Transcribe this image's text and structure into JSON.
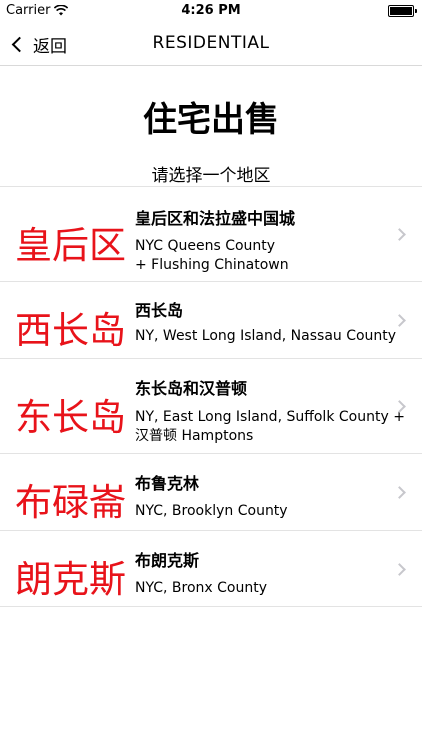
{
  "status_bar": {
    "carrier": "Carrier",
    "time": "4:26 PM"
  },
  "nav": {
    "back_label": "返回",
    "title": "RESIDENTIAL"
  },
  "page": {
    "title": "住宅出售",
    "subtitle": "请选择一个地区"
  },
  "regions": [
    {
      "short": "皇后区",
      "name": "皇后区和法拉盛中国城",
      "desc_line1": "NYC Queens County",
      "desc_line2": "+ Flushing Chinatown"
    },
    {
      "short": "西长岛",
      "name": "西长岛",
      "desc_line1": "NY, West Long Island, Nassau County",
      "desc_line2": ""
    },
    {
      "short": "东长岛",
      "name": "东长岛和汉普顿",
      "desc_line1": "NY, East Long Island, Suffolk County +",
      "desc_line2": "汉普顿 Hamptons"
    },
    {
      "short": "布碌崙",
      "name": "布鲁克林",
      "desc_line1": "NYC, Brooklyn County",
      "desc_line2": ""
    },
    {
      "short": "朗克斯",
      "name": "布朗克斯",
      "desc_line1": "NYC, Bronx County",
      "desc_line2": ""
    }
  ],
  "colors": {
    "accent": "#e8131a",
    "separator": "#e3e3e3",
    "chevron": "#c7c7cc"
  }
}
